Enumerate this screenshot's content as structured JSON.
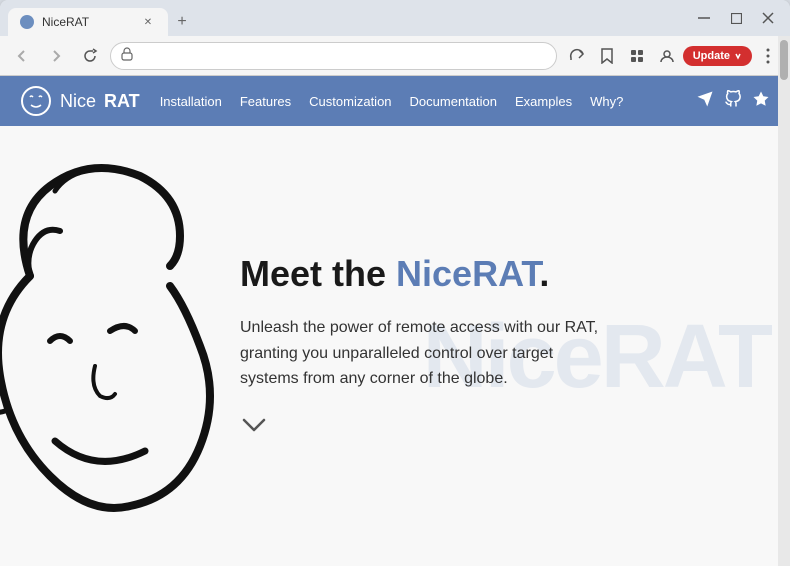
{
  "browser": {
    "tab_title": "NiceRAT",
    "url": "",
    "nav": {
      "back_label": "←",
      "forward_label": "→",
      "reload_label": "↻"
    },
    "toolbar": {
      "share_icon": "⬆",
      "star_icon": "☆",
      "extensions_icon": "⬛",
      "profile_icon": "👤",
      "update_label": "Update",
      "menu_icon": "⋮"
    },
    "window_controls": {
      "minimize": "─",
      "maximize": "□",
      "close": "✕"
    }
  },
  "site": {
    "logo_nice": "Nice",
    "logo_rat": "RAT",
    "nav_items": [
      "Installation",
      "Features",
      "Customization",
      "Documentation",
      "Examples",
      "Why?"
    ],
    "nav_icons": [
      "✈",
      "⭕",
      "★"
    ],
    "hero": {
      "title_plain": "Meet the ",
      "title_highlight": "NiceRAT",
      "title_end": ".",
      "description": "Unleash the power of remote access with our RAT, granting you unparalleled control over target systems from any corner of the globe.",
      "scroll_icon": "∨"
    },
    "watermark": "NiceRAT"
  }
}
